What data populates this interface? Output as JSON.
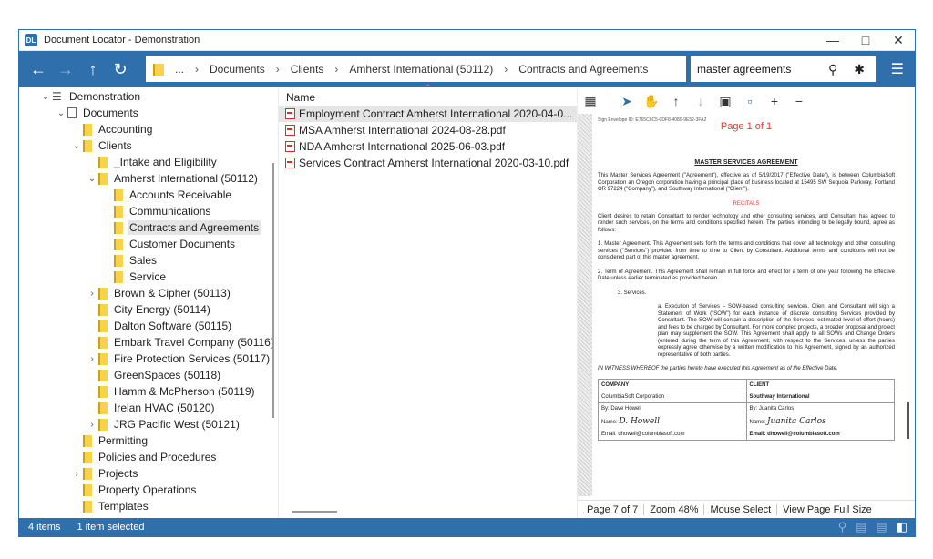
{
  "window": {
    "title": "Document Locator - Demonstration",
    "app_icon_text": "DL"
  },
  "toolbar": {
    "breadcrumb": {
      "ellipsis": "...",
      "items": [
        "Documents",
        "Clients",
        "Amherst International (50112)",
        "Contracts and Agreements"
      ]
    },
    "search_value": "master agreements"
  },
  "tree": {
    "rows": [
      {
        "label": "Demonstration",
        "indent": 0,
        "chevron": "down",
        "icon": "stack",
        "selected": false
      },
      {
        "label": "Documents",
        "indent": 1,
        "chevron": "down",
        "icon": "doc",
        "selected": false
      },
      {
        "label": "Accounting",
        "indent": 2,
        "chevron": "",
        "icon": "folder",
        "selected": false
      },
      {
        "label": "Clients",
        "indent": 2,
        "chevron": "down",
        "icon": "folder",
        "selected": false
      },
      {
        "label": "_Intake and Eligibility",
        "indent": 3,
        "chevron": "",
        "icon": "folder",
        "selected": false
      },
      {
        "label": "Amherst International (50112)",
        "indent": 3,
        "chevron": "down",
        "icon": "folder",
        "selected": false
      },
      {
        "label": "Accounts Receivable",
        "indent": 4,
        "chevron": "",
        "icon": "folder",
        "selected": false
      },
      {
        "label": "Communications",
        "indent": 4,
        "chevron": "",
        "icon": "folder",
        "selected": false
      },
      {
        "label": "Contracts and Agreements",
        "indent": 4,
        "chevron": "",
        "icon": "folder",
        "selected": true
      },
      {
        "label": "Customer Documents",
        "indent": 4,
        "chevron": "",
        "icon": "folder",
        "selected": false
      },
      {
        "label": "Sales",
        "indent": 4,
        "chevron": "",
        "icon": "folder",
        "selected": false
      },
      {
        "label": "Service",
        "indent": 4,
        "chevron": "",
        "icon": "folder",
        "selected": false
      },
      {
        "label": "Brown & Cipher (50113)",
        "indent": 3,
        "chevron": "right",
        "icon": "folder",
        "selected": false
      },
      {
        "label": "City Energy (50114)",
        "indent": 3,
        "chevron": "",
        "icon": "folder",
        "selected": false
      },
      {
        "label": "Dalton Software (50115)",
        "indent": 3,
        "chevron": "",
        "icon": "folder",
        "selected": false
      },
      {
        "label": "Embark Travel Company (50116)",
        "indent": 3,
        "chevron": "",
        "icon": "folder",
        "selected": false
      },
      {
        "label": "Fire Protection Services (50117)",
        "indent": 3,
        "chevron": "right",
        "icon": "folder",
        "selected": false
      },
      {
        "label": "GreenSpaces (50118)",
        "indent": 3,
        "chevron": "",
        "icon": "folder",
        "selected": false
      },
      {
        "label": "Hamm & McPherson (50119)",
        "indent": 3,
        "chevron": "",
        "icon": "folder",
        "selected": false
      },
      {
        "label": "Irelan HVAC (50120)",
        "indent": 3,
        "chevron": "",
        "icon": "folder",
        "selected": false
      },
      {
        "label": "JRG Pacific West (50121)",
        "indent": 3,
        "chevron": "right",
        "icon": "folder",
        "selected": false
      },
      {
        "label": "Permitting",
        "indent": 2,
        "chevron": "",
        "icon": "folder",
        "selected": false
      },
      {
        "label": "Policies and Procedures",
        "indent": 2,
        "chevron": "",
        "icon": "folder",
        "selected": false
      },
      {
        "label": "Projects",
        "indent": 2,
        "chevron": "right",
        "icon": "folder",
        "selected": false
      },
      {
        "label": "Property Operations",
        "indent": 2,
        "chevron": "",
        "icon": "folder",
        "selected": false
      },
      {
        "label": "Templates",
        "indent": 2,
        "chevron": "",
        "icon": "folder",
        "selected": false
      }
    ]
  },
  "file_list": {
    "column_header": "Name",
    "files": [
      {
        "name": "Employment Contract Amherst International 2020-04-0...",
        "selected": true
      },
      {
        "name": "MSA Amherst International 2024-08-28.pdf",
        "selected": false
      },
      {
        "name": "NDA Amherst International 2025-06-03.pdf",
        "selected": false
      },
      {
        "name": "Services Contract Amherst International 2020-03-10.pdf",
        "selected": false
      }
    ]
  },
  "preview": {
    "envelope_id": "Sign Envelope ID: E765C6C5-0DF8-4080-9E52-3FA2",
    "page_of": "Page 1 of 1",
    "doc_title": "MASTER SERVICES AGREEMENT",
    "intro_para": "This Master Services Agreement (\"Agreement\"), effective as of 5/19/2017 (\"Effective Date\"), is between ColumbiaSoft Corporation an Oregon corporation having a principal place of business located at 15495 SW Sequoia Parkway, Portland OR 97224 (\"Company\"), and Southway International (\"Client\").",
    "recitals": "RECITALS",
    "recital_para": "Client desires to retain Consultant to render technology and other consulting services, and Consultant has agreed to render such services, on the terms and conditions specified herein. The parties, intending to be legally bound, agree as follows:",
    "clause1": "1. Master Agreement. This Agreement sets forth the terms and conditions that cover all technology and other consulting services (\"Services\") provided from time to time to Client by Consultant. Additional terms and conditions will not be considered part of this master agreement.",
    "clause2": "2. Term of Agreement. This Agreement shall remain in full force and effect for a term of one year following the Effective Date unless earlier terminated as provided herein.",
    "clause3": "3. Services.",
    "clause3a": "a. Execution of Services – SOW-based consulting services. Client and Consultant will sign a Statement of Work (\"SOW\") for each instance of discrete consulting Services provided by Consultant. The SOW will contain a description of the Services, estimated level of effort (hours) and fees to be charged by Consultant. For more complex projects, a broader proposal and project plan may supplement the SOW. This Agreement shall apply to all SOWs and Change Orders (entered during the term of this Agreement, with respect to the Services, unless the parties expressly agree otherwise by a written modification to this Agreement, signed by an authorized representative of both parties.",
    "witness": "IN WITNESS WHEREOF the parties hereto have executed this Agreement as of the Effective Date.",
    "sig": {
      "company_header": "COMPANY",
      "client_header": "CLIENT",
      "company_name": "ColumbiaSoft Corporation",
      "client_name": "Southway International",
      "company_by": "By: Dave Howell",
      "client_by": "By: Juanita Carlos",
      "name_label": "Name:",
      "company_signature": "D. Howell",
      "client_signature": "Juanita Carlos",
      "company_email": "Email: dhowell@columbiasoft.com",
      "client_email": "Email: dhowell@columbiasoft.com"
    },
    "status": {
      "page": "Page 7 of 7",
      "zoom": "Zoom 48%",
      "mode": "Mouse Select",
      "view": "View Page Full Size"
    }
  },
  "statusbar": {
    "items_count": "4 items",
    "selected": "1 item selected"
  },
  "colors": {
    "accent": "#2f6fab",
    "folder": "#f7d24a",
    "pdf_red": "#d93025",
    "recitals_red": "#e53935"
  }
}
